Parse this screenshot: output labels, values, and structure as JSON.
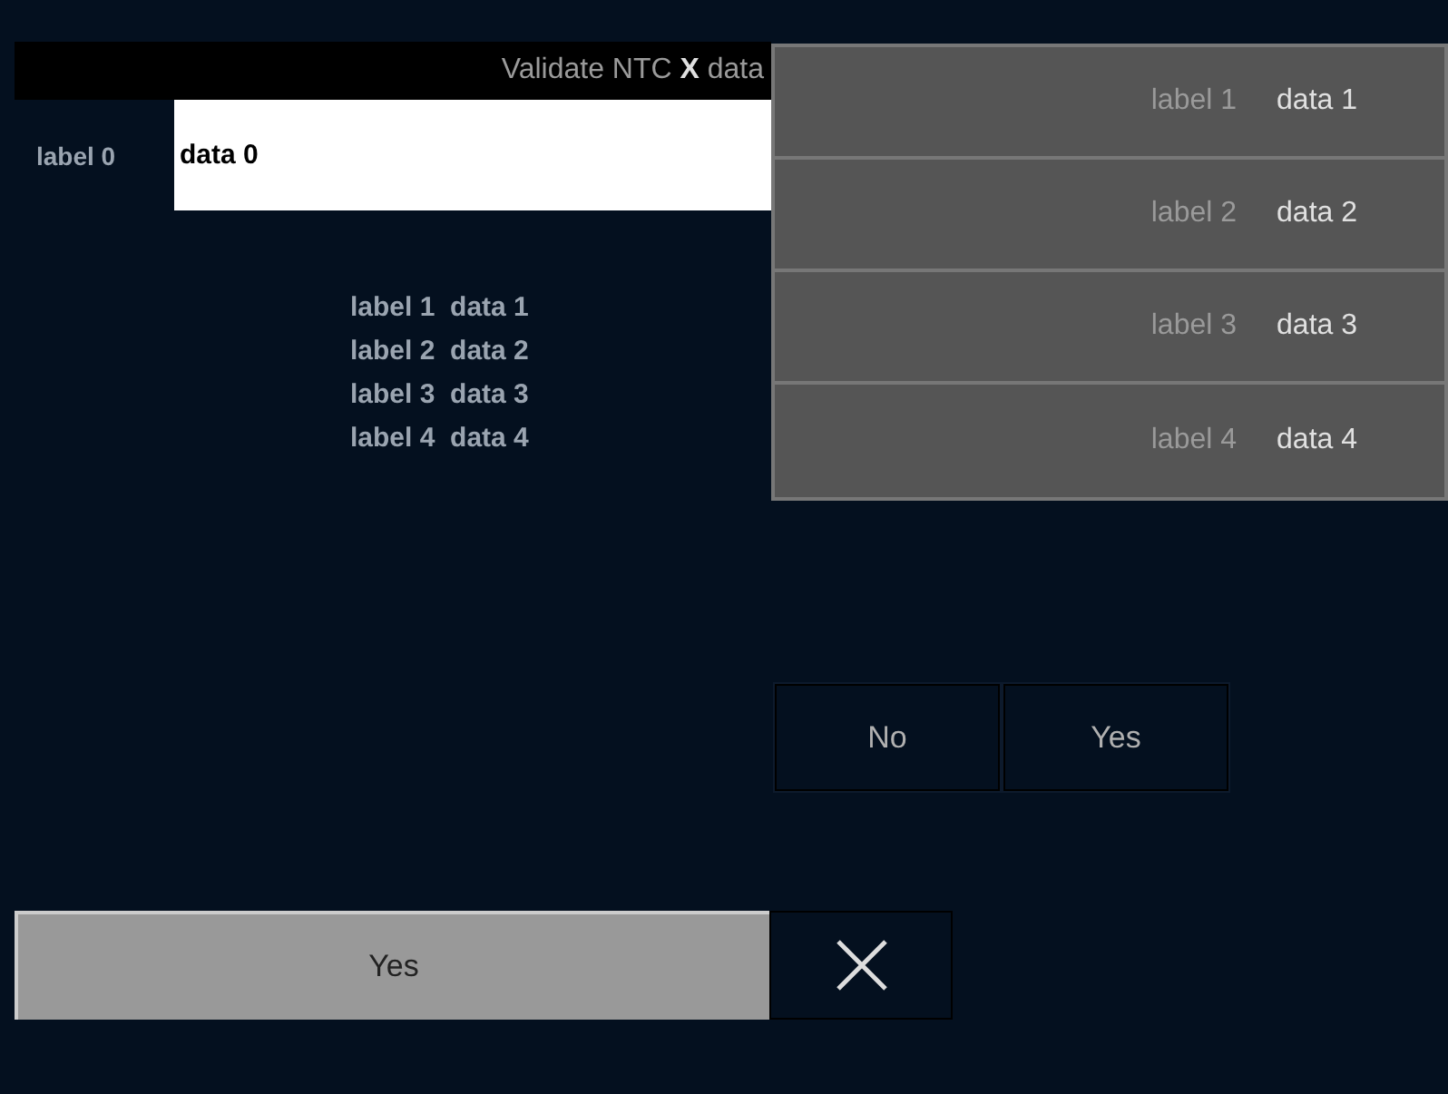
{
  "title": "Validate NTC **X** data",
  "field": {
    "label": "label 0",
    "value": "data 0"
  },
  "details": [
    {
      "label": "label 1",
      "value": "data 1"
    },
    {
      "label": "label 2",
      "value": "data 2"
    },
    {
      "label": "label 3",
      "value": "data 3"
    },
    {
      "label": "label 4",
      "value": "data 4"
    }
  ],
  "dropdown": [
    {
      "label": "label 1",
      "value": "data 1"
    },
    {
      "label": "label 2",
      "value": "data 2"
    },
    {
      "label": "label 3",
      "value": "data 3"
    },
    {
      "label": "label 4",
      "value": "data 4"
    }
  ],
  "confirm_buttons": [
    "No",
    "Yes"
  ],
  "bottom_button": "Yes"
}
